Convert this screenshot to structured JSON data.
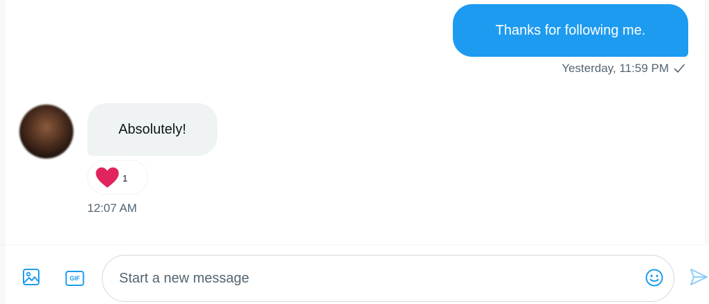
{
  "colors": {
    "accent": "#1d9bf0",
    "received_bubble": "#eff3f4",
    "muted_text": "#536471",
    "heart": "#e0245e"
  },
  "conversation": {
    "sent_message": {
      "text": "Thanks for following me.",
      "timestamp": "Yesterday, 11:59 PM",
      "status_icon": "check-icon"
    },
    "received_message": {
      "text": "Absolutely!",
      "avatar_icon": "avatar",
      "reaction": {
        "icon": "heart-icon",
        "count": "1"
      },
      "timestamp": "12:07 AM"
    }
  },
  "composer": {
    "media_icon": "image-icon",
    "gif_icon": "gif-icon",
    "gif_label": "GIF",
    "placeholder": "Start a new message",
    "emoji_icon": "emoji-icon",
    "send_icon": "send-icon"
  }
}
